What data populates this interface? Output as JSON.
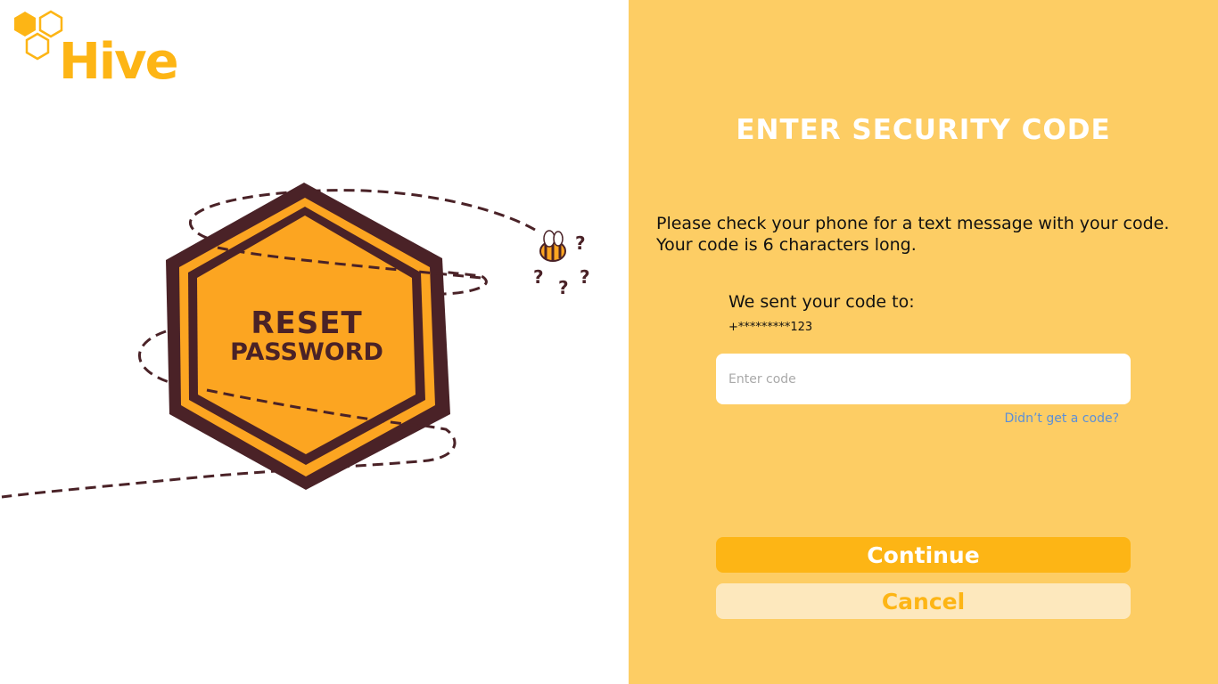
{
  "brand": {
    "name": "Hive",
    "accent_color": "#fdb515",
    "panel_color": "#fdcd64",
    "dark_color": "#4a2227"
  },
  "illustration": {
    "line1": "RESET",
    "line2": "PASSWORD",
    "icons": [
      "hexagon-badge-icon",
      "bee-icon",
      "question-mark-icon"
    ]
  },
  "form": {
    "heading": "ENTER SECURITY CODE",
    "instruction_line1": "Please check your phone for a text message with your code.",
    "instruction_line2": "Your code is 6 characters long.",
    "sent_to_label": "We sent your code to:",
    "phone_masked": "+*********123",
    "code_placeholder": "Enter code",
    "code_value": "",
    "resend_link": "Didn’t get a code?",
    "continue_label": "Continue",
    "cancel_label": "Cancel"
  }
}
